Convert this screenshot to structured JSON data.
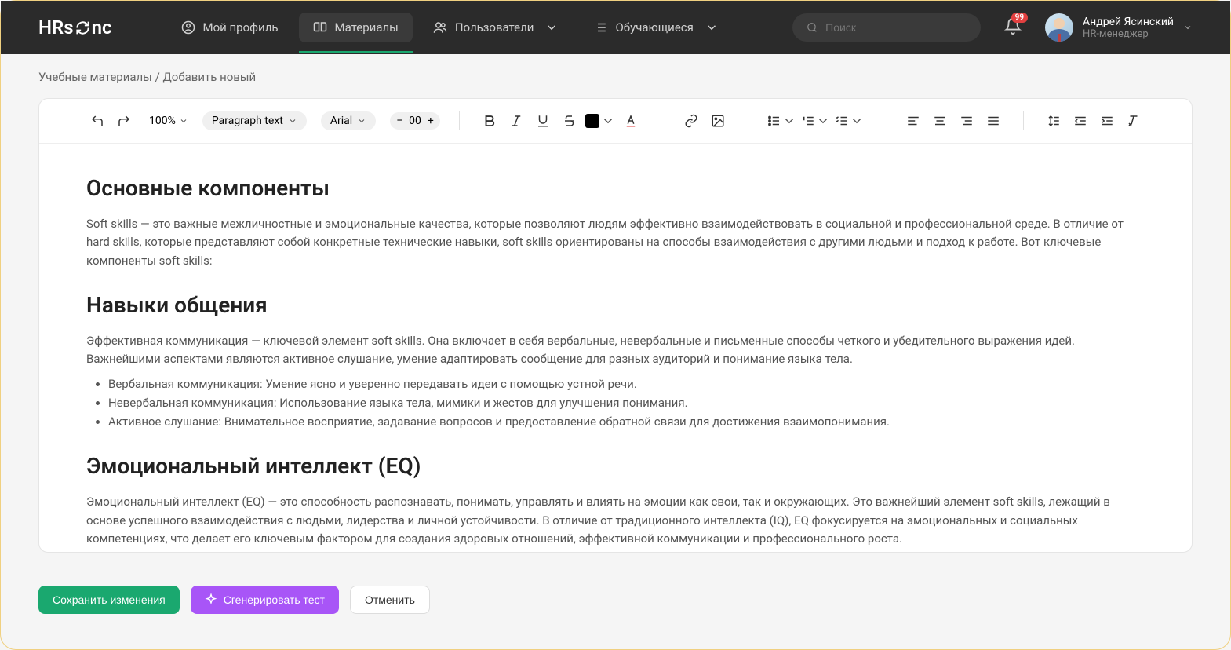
{
  "app": {
    "logo_a": "HRs",
    "logo_b": "nc",
    "logo_full": "HRsync"
  },
  "nav": {
    "profile": "Мой профиль",
    "materials": "Материалы",
    "users": "Пользователи",
    "learners": "Обучающиеся"
  },
  "search": {
    "placeholder": "Поиск"
  },
  "notifications": {
    "count": "99"
  },
  "user": {
    "name": "Андрей Ясинский",
    "role": "HR-менеджер"
  },
  "breadcrumb": {
    "root": "Учебные материалы",
    "sep": " / ",
    "current": "Добавить новый"
  },
  "toolbar": {
    "zoom": "100%",
    "para_style": "Paragraph text",
    "font": "Arial",
    "font_size": "00"
  },
  "content": {
    "h1": "Основные компоненты",
    "p1": "Soft skills — это важные межличностные и эмоциональные качества, которые позволяют людям эффективно взаимодействовать в социальной и профессиональной среде. В отличие от hard skills, которые представляют собой конкретные технические навыки, soft skills ориентированы на способы взаимодействия с другими людьми и подход к работе. Вот ключевые компоненты soft skills:",
    "h2": "Навыки общения",
    "p2": "Эффективная коммуникация — ключевой элемент soft skills. Она включает в себя вербальные, невербальные и письменные способы четкого и убедительного выражения идей. Важнейшими аспектами являются активное слушание, умение адаптировать сообщение для разных аудиторий и понимание языка тела.",
    "li1": "Вербальная коммуникация: Умение ясно и уверенно передавать идеи с помощью устной речи.",
    "li2": "Невербальная коммуникация: Использование языка тела, мимики и жестов для улучшения понимания.",
    "li3": "Активное слушание: Внимательное восприятие, задавание вопросов и предоставление обратной связи для достижения взаимопонимания.",
    "h3": "Эмоциональный интеллект (EQ)",
    "p3": "Эмоциональный интеллект (EQ) — это способность распознавать, понимать, управлять и влиять на эмоции как свои, так и окружающих. Это важнейший элемент soft skills, лежащий в основе успешного взаимодействия с людьми, лидерства и личной устойчивости. В отличие от традиционного интеллекта (IQ), EQ фокусируется на эмоциональных и социальных компетенциях, что делает его ключевым фактором для создания здоровых отношений, эффективной коммуникации и профессионального роста."
  },
  "buttons": {
    "save": "Сохранить изменения",
    "generate": "Сгенерировать тест",
    "cancel": "Отменить"
  }
}
